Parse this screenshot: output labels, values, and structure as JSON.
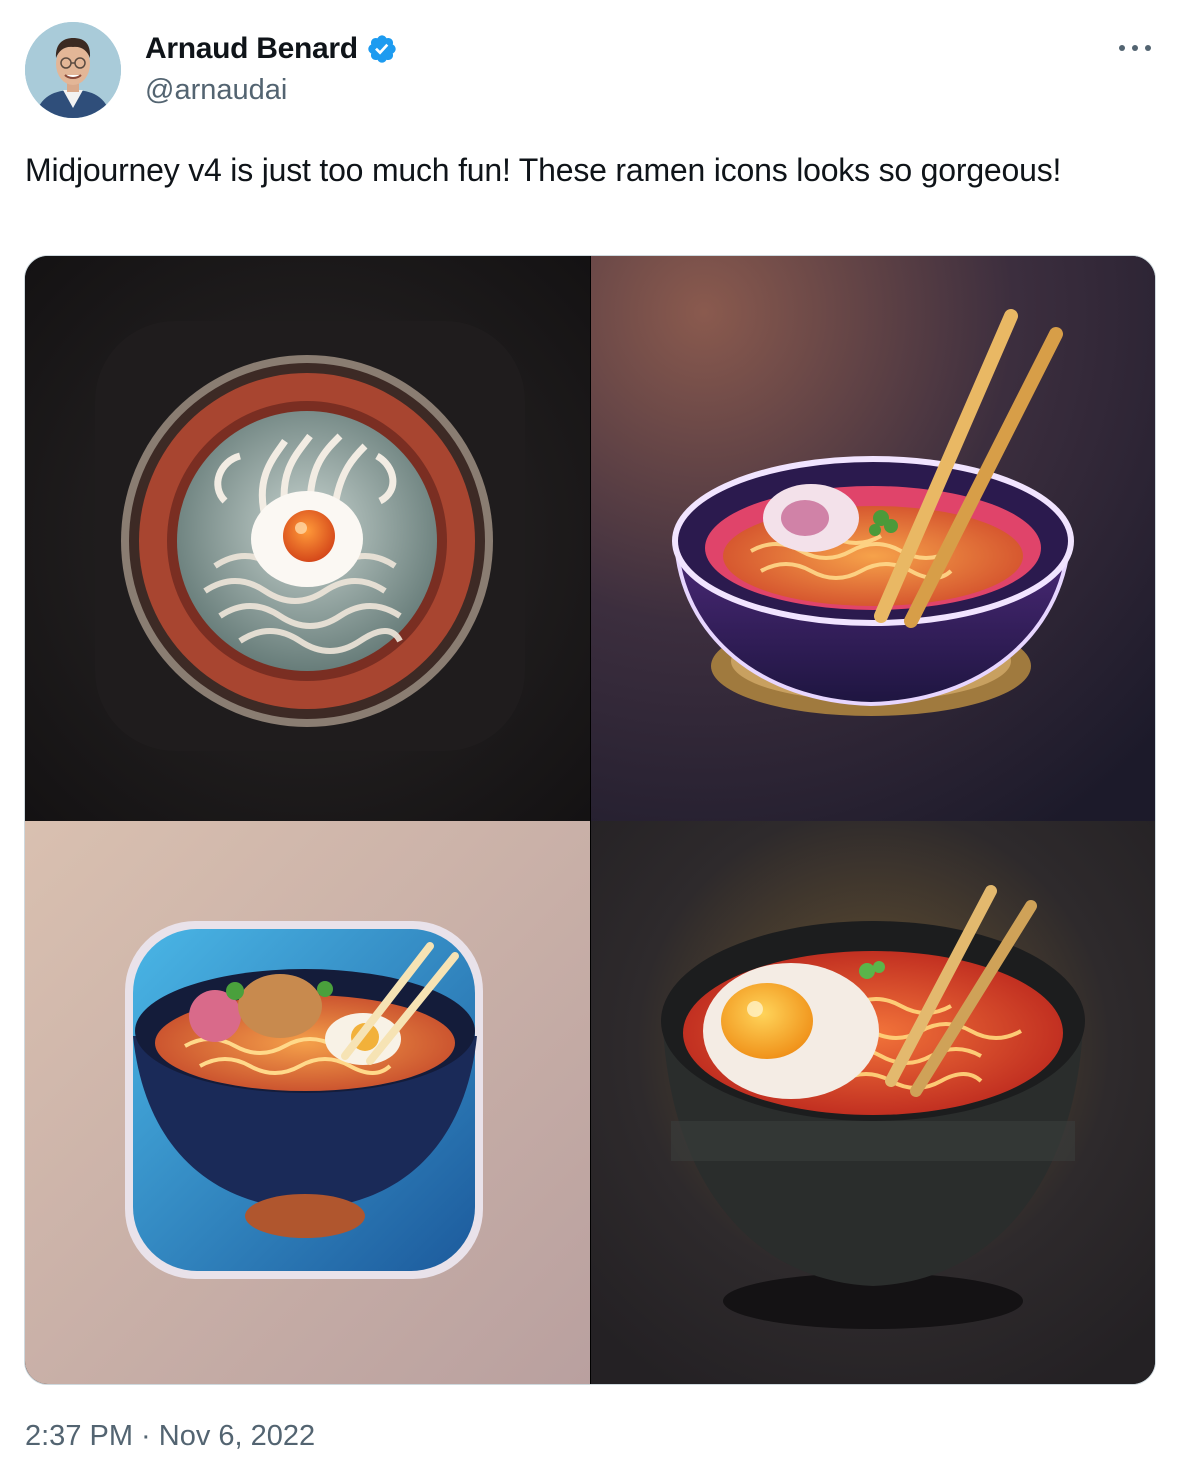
{
  "author": {
    "display_name": "Arnaud Benard",
    "handle": "@arnaudai",
    "verified": true,
    "verified_color": "#1d9bf0"
  },
  "tweet": {
    "text": "Midjourney v4 is just too much fun! These ramen icons looks so gorgeous!",
    "timestamp": "2:37 PM · Nov 6, 2022"
  },
  "media": {
    "count": 4,
    "images": [
      {
        "subject": "ramen bowl icon, top view, egg and noodles in red bowl"
      },
      {
        "subject": "ramen bowl icon, purple bowl with chopsticks"
      },
      {
        "subject": "ramen app icon, blue rounded square"
      },
      {
        "subject": "ramen bowl icon, black bowl with egg and chopsticks"
      }
    ]
  },
  "icons": {
    "more": "more-horizontal-icon",
    "verified": "verified-badge-icon"
  },
  "colors": {
    "text_primary": "#0f1419",
    "text_secondary": "#536471",
    "border": "#cfd9de"
  }
}
